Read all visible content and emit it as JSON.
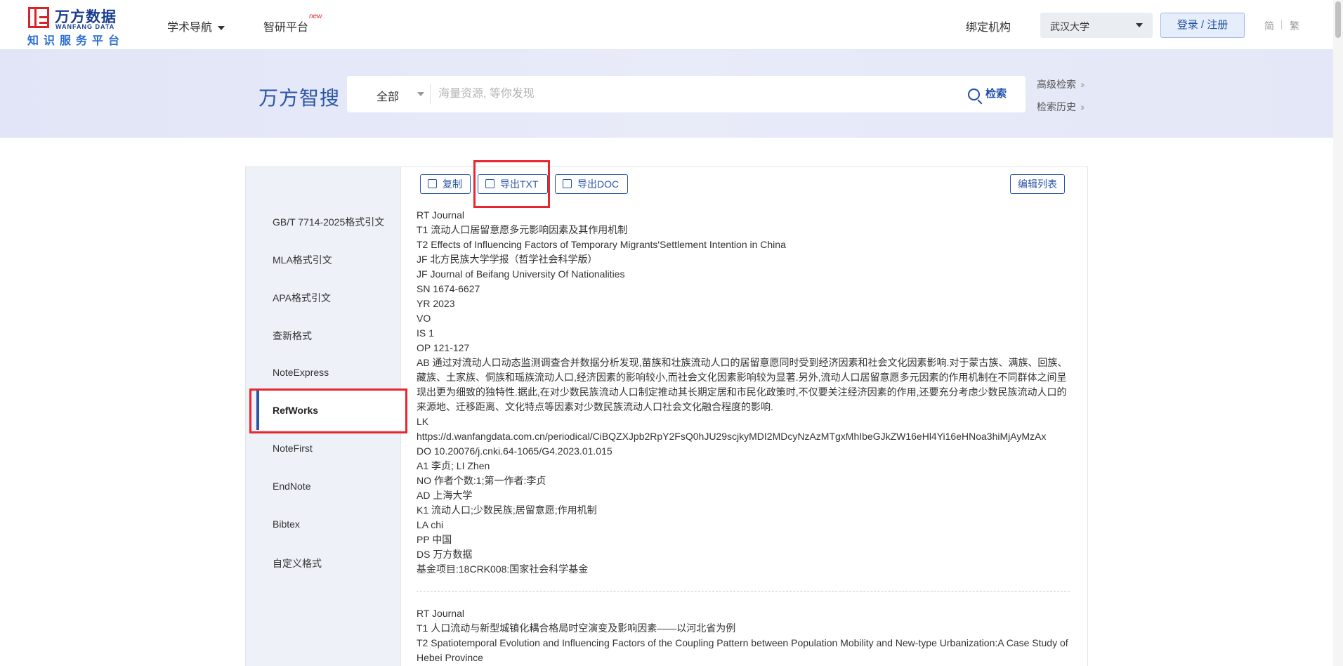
{
  "logo": {
    "brand_cn": "万方数据",
    "brand_en": "WANFANG DATA",
    "platform": "知识服务平台"
  },
  "nav": {
    "academic_nav": "学术导航",
    "zhiyan_platform": "智研平台",
    "new_badge": "new"
  },
  "header_right": {
    "bind_org": "绑定机构",
    "org_selected": "武汉大学",
    "login": "登录 / 注册",
    "lang_simplified": "简",
    "lang_traditional": "繁"
  },
  "search": {
    "title": "万方智搜",
    "scope": "全部",
    "placeholder": "海量资源, 等你发现",
    "button": "检索",
    "advanced": "高级检索",
    "history": "检索历史"
  },
  "toolbar": {
    "copy": "复制",
    "export_txt": "导出TXT",
    "export_doc": "导出DOC",
    "edit_list": "编辑列表"
  },
  "formats": [
    "GB/T 7714-2025格式引文",
    "MLA格式引文",
    "APA格式引文",
    "查新格式",
    "NoteExpress",
    "RefWorks",
    "NoteFirst",
    "EndNote",
    "Bibtex",
    "自定义格式"
  ],
  "active_format": "RefWorks",
  "record1": {
    "rt": "RT Journal",
    "t1": "T1 流动人口居留意愿多元影响因素及其作用机制",
    "t2": "T2 Effects of Influencing Factors of Temporary Migrants'Settlement Intention in China",
    "jf1": "JF 北方民族大学学报（哲学社会科学版）",
    "jf2": "JF Journal of Beifang University Of Nationalities",
    "sn": "SN 1674-6627",
    "yr": "YR 2023",
    "vo": "VO",
    "is": "IS 1",
    "op": "OP 121-127",
    "ab": "AB 通过对流动人口动态监测调查合并数据分析发现,苗族和壮族流动人口的居留意愿同时受到经济因素和社会文化因素影响.对于蒙古族、满族、回族、藏族、土家族、侗族和瑶族流动人口,经济因素的影响较小,而社会文化因素影响较为显著.另外,流动人口居留意愿多元因素的作用机制在不同群体之间呈现出更为细致的独特性.据此,在对少数民族流动人口制定推动其长期定居和市民化政策时,不仅要关注经济因素的作用,还要充分考虑少数民族流动人口的来源地、迁移距离、文化特点等因素对少数民族流动人口社会文化融合程度的影响.",
    "lk": "LK",
    "url": "https://d.wanfangdata.com.cn/periodical/CiBQZXJpb2RpY2FsQ0hJU29scjkyMDI2MDcyNzAzMTgxMhIbeGJkZW16eHl4Yi16eHNoa3hiMjAyMzAx",
    "do": "DO 10.20076/j.cnki.64-1065/G4.2023.01.015",
    "a1": "A1 李贞; LI Zhen",
    "no": "NO 作者个数:1;第一作者:李贞",
    "ad": "AD 上海大学",
    "k1": "K1 流动人口;少数民族;居留意愿;作用机制",
    "la": "LA chi",
    "pp": "PP 中国",
    "ds": "DS 万方数据",
    "fund": "基金项目:18CRK008:国家社会科学基金"
  },
  "record2": {
    "rt": "RT Journal",
    "t1": "T1 人口流动与新型城镇化耦合格局时空演变及影响因素——以河北省为例",
    "t2": "T2 Spatiotemporal Evolution and Influencing Factors of the Coupling Pattern between Population Mobility and New-type Urbanization:A Case Study of Hebei Province"
  },
  "colors": {
    "brand_blue": "#2a55a6",
    "highlight_red": "#e8262c",
    "side_bg": "#eef1f8"
  }
}
